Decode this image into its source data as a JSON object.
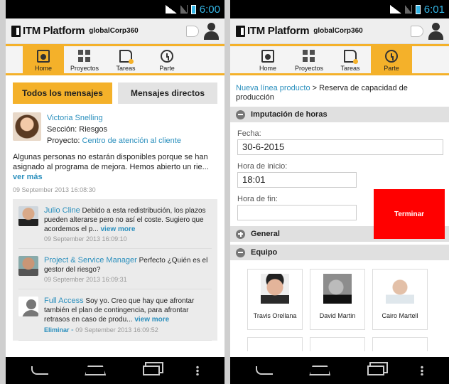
{
  "status": {
    "left_time": "6:00",
    "right_time": "6:01"
  },
  "app": {
    "brand": "ITM Platform",
    "company": "globalCorp360"
  },
  "nav": [
    {
      "label": "Home",
      "icon": "home-icon"
    },
    {
      "label": "Proyectos",
      "icon": "projects-icon"
    },
    {
      "label": "Tareas",
      "icon": "tasks-icon"
    },
    {
      "label": "Parte",
      "icon": "clock-icon"
    }
  ],
  "left": {
    "tabs": [
      "Todos los mensajes",
      "Mensajes directos"
    ],
    "post": {
      "author": "Victoria Snelling",
      "section_label": "Sección:",
      "section": "Riesgos",
      "project_label": "Proyecto:",
      "project": "Centro de atención al cliente",
      "body": "Algunas personas no estarán disponibles porque se han asignado al programa de mejora. Hemos abierto un rie...",
      "more": "ver más",
      "date": "09 September 2013 16:08:30"
    },
    "replies": [
      {
        "author": "Julio Cline",
        "text": "Debido a esta redistribución, los plazos pueden alterarse pero no así el coste. Sugiero que acordemos el p...",
        "more": "view more",
        "date": "09 September 2013 16:09:10"
      },
      {
        "author": "Project & Service Manager",
        "text": "Perfecto ¿Quién es el gestor del riesgo?",
        "more": "",
        "date": "09 September 2013 16:09:31"
      },
      {
        "author": "Full Access",
        "text": "Soy yo. Creo que hay que afrontar también el plan de contingencia, para afrontar retrasos en caso de produ...",
        "more": "view more",
        "delete": "Eliminar",
        "sep": "-",
        "date": "09 September 2013 16:09:52"
      }
    ]
  },
  "right": {
    "breadcrumb_link": "Nueva línea producto",
    "breadcrumb_sep": ">",
    "breadcrumb_current": "Reserva de capacidad de producción",
    "sections": {
      "hours": "Imputación de horas",
      "general": "General",
      "team": "Equipo"
    },
    "form": {
      "date_label": "Fecha:",
      "date_value": "30-6-2015",
      "start_label": "Hora de inicio:",
      "start_value": "18:01",
      "end_label": "Hora de fin:",
      "end_value": "",
      "stop_button": "Terminar"
    },
    "team": [
      "Travis Orellana",
      "David Martin",
      "Cairo Martell"
    ]
  }
}
